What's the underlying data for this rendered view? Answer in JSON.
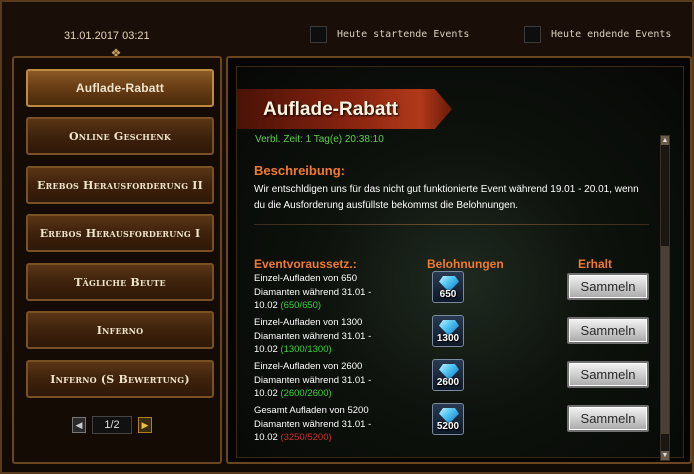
{
  "header": {
    "datetime": "31.01.2017 03:21",
    "checkbox_start_label": "Heute startende Events",
    "checkbox_end_label": "Heute endende Events"
  },
  "sidebar": {
    "items": [
      {
        "label": "Auflade-Rabatt",
        "active": true
      },
      {
        "label": "Online Geschenk",
        "active": false
      },
      {
        "label": "Erebos Herausforderung II",
        "active": false
      },
      {
        "label": "Erebos Herausforderung I",
        "active": false
      },
      {
        "label": "Tägliche Beute",
        "active": false
      },
      {
        "label": "Inferno",
        "active": false
      },
      {
        "label": "Inferno (S Bewertung)",
        "active": false
      }
    ],
    "pager": {
      "text": "1/2"
    }
  },
  "main": {
    "title": "Auflade-Rabatt",
    "timer": "Verbl. Zeit: 1 Tag(e)  20:38:10",
    "description_heading": "Beschreibung:",
    "description_text": "Wir entschldigen uns für das nicht gut funktionierte Event während 19.01 - 20.01, wenn du die Ausforderung ausfüllste bekommst die Belohnungen.",
    "columns": {
      "condition": "Eventvoraussetz.:",
      "rewards": "Belohnungen",
      "received": "Erhalt"
    },
    "rows": [
      {
        "line1": "Einzel-Aufladen von 650",
        "line2": "Diamanten während 31.01 -",
        "line3": "10.02",
        "progress": "(650/650)",
        "progress_complete": true,
        "reward": "650",
        "button": "Sammeln"
      },
      {
        "line1": "Einzel-Aufladen von 1300",
        "line2": "Diamanten während 31.01 -",
        "line3": "10.02",
        "progress": "(1300/1300)",
        "progress_complete": true,
        "reward": "1300",
        "button": "Sammeln"
      },
      {
        "line1": "Einzel-Aufladen von 2600",
        "line2": "Diamanten während 31.01 -",
        "line3": "10.02",
        "progress": "(2600/2600)",
        "progress_complete": true,
        "reward": "2600",
        "button": "Sammeln"
      },
      {
        "line1": "Gesamt Aufladen von 5200",
        "line2": "Diamanten während 31.01 -",
        "line3": "10.02",
        "progress": "(3250/5200)",
        "progress_complete": false,
        "reward": "5200",
        "button": "Sammeln"
      }
    ]
  },
  "colors": {
    "accent_orange": "#f07a30",
    "timer_green": "#5ad24a",
    "progress_ok": "#3ad23a",
    "progress_bad": "#d03030"
  },
  "icons": {
    "reward": "diamond-icon",
    "pager_prev": "arrow-left-icon",
    "pager_next": "arrow-right-icon",
    "ornament": "ornament-icon"
  }
}
